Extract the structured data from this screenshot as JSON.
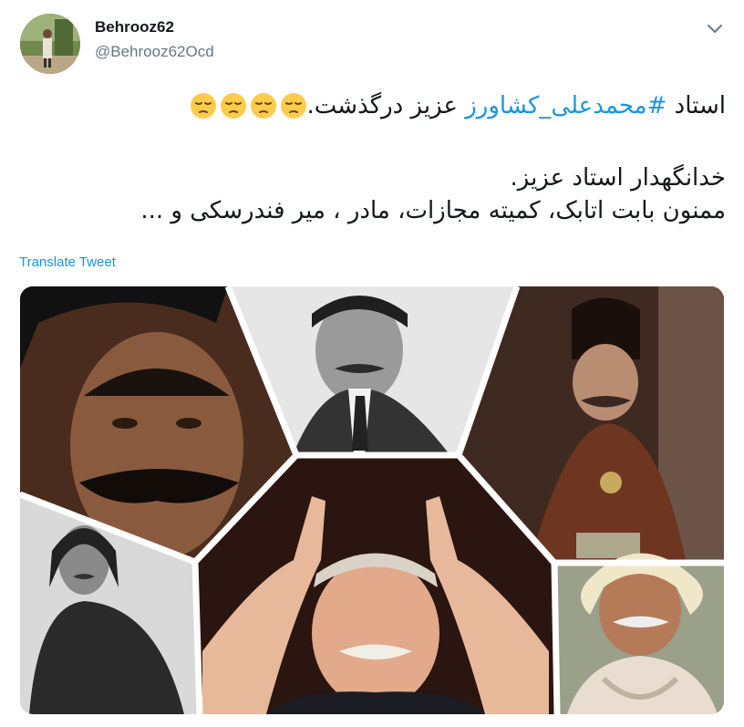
{
  "user": {
    "display_name": "Behrooz62",
    "handle": "@Behrooz62Ocd"
  },
  "tweet": {
    "line1_before": "استاد ",
    "hashtag": "#محمدعلی_کشاورز",
    "line1_after": " عزیز درگذشت.",
    "line1_emoji": [
      "pensive-face",
      "pensive-face",
      "pensive-face",
      "pensive-face"
    ],
    "line2": "خدانگهدار استاد عزیز.",
    "line3": "ممنون بابت اتابک، کمیته مجازات، مادر ، میر فندرسکی و ..."
  },
  "translate_label": "Translate Tweet",
  "colors": {
    "link": "#1b95e0",
    "text": "#14171a",
    "secondary": "#657786"
  },
  "media": {
    "panels": [
      "portrait-top-left",
      "portrait-top-center",
      "portrait-top-right",
      "portrait-bottom-left",
      "portrait-bottom-center",
      "portrait-bottom-right"
    ]
  }
}
